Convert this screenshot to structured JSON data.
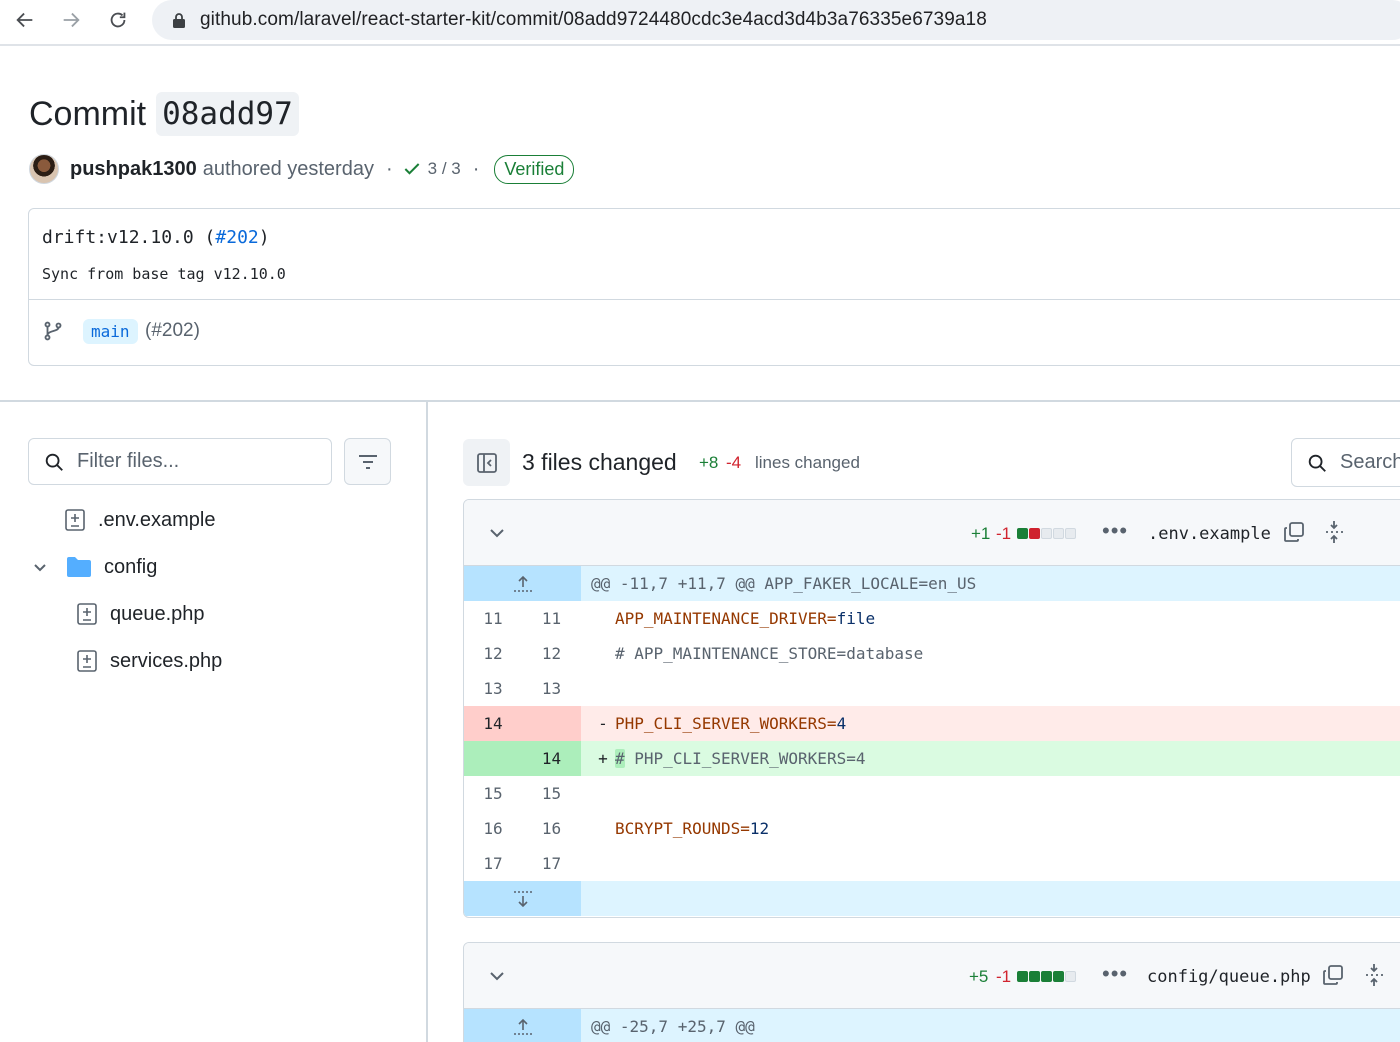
{
  "browser": {
    "url": "github.com/laravel/react-starter-kit/commit/08add9724480cdc3e4acd3d4b3a76335e6739a18"
  },
  "commit": {
    "title_word": "Commit",
    "short_sha": "08add97",
    "author": "pushpak1300",
    "authored_text": "authored yesterday",
    "separator": "·",
    "checks": "3 / 3",
    "verified": "Verified",
    "message_title_prefix": "drift:v12.10.0 (",
    "message_pr": "#202",
    "message_title_suffix": ")",
    "message_body": "Sync from base tag v12.10.0",
    "branch": "main",
    "branch_pr": "(#202)"
  },
  "file_tree": {
    "filter_placeholder": "Filter files...",
    "items": [
      {
        "name": ".env.example",
        "type": "file-diff"
      },
      {
        "name": "config",
        "type": "folder"
      },
      {
        "name": "queue.php",
        "type": "file-diff"
      },
      {
        "name": "services.php",
        "type": "file-diff"
      }
    ]
  },
  "diff_toolbar": {
    "files_changed": "3 files changed",
    "additions": "+8",
    "deletions": "-4",
    "lines_changed": "lines changed",
    "search_label": "Search"
  },
  "files": [
    {
      "additions": "+1",
      "deletions": "-1",
      "diffstat": [
        "add",
        "del",
        "neu",
        "neu",
        "neu"
      ],
      "more": "•••",
      "name": ".env.example",
      "hunk": "@@ -11,7 +11,7 @@ APP_FAKER_LOCALE=en_US",
      "lines": [
        {
          "old": "11",
          "new": "11",
          "type": "ctx",
          "sign": "",
          "key": "APP_MAINTENANCE_DRIVER",
          "eq": "=",
          "val": "file",
          "text": ""
        },
        {
          "old": "12",
          "new": "12",
          "type": "ctx",
          "sign": "",
          "key": "",
          "eq": "",
          "val": "",
          "text": "# APP_MAINTENANCE_STORE=database"
        },
        {
          "old": "13",
          "new": "13",
          "type": "ctx",
          "sign": "",
          "key": "",
          "eq": "",
          "val": "",
          "text": ""
        },
        {
          "old": "14",
          "new": "",
          "type": "del",
          "sign": "-",
          "key": "PHP_CLI_SERVER_WORKERS",
          "eq": "=",
          "val": "4",
          "text": ""
        },
        {
          "old": "",
          "new": "14",
          "type": "add",
          "sign": "+",
          "key": "",
          "eq": "",
          "val": "",
          "text": "PHP_CLI_SERVER_WORKERS=4",
          "hl": "#"
        },
        {
          "old": "15",
          "new": "15",
          "type": "ctx",
          "sign": "",
          "key": "",
          "eq": "",
          "val": "",
          "text": ""
        },
        {
          "old": "16",
          "new": "16",
          "type": "ctx",
          "sign": "",
          "key": "BCRYPT_ROUNDS",
          "eq": "=",
          "val": "12",
          "text": ""
        },
        {
          "old": "17",
          "new": "17",
          "type": "ctx",
          "sign": "",
          "key": "",
          "eq": "",
          "val": "",
          "text": ""
        }
      ]
    },
    {
      "additions": "+5",
      "deletions": "-1",
      "diffstat": [
        "add",
        "add",
        "add",
        "add",
        "neu"
      ],
      "more": "•••",
      "name": "config/queue.php",
      "hunk": "@@ -25,7 +25,7 @@"
    }
  ],
  "colors": {
    "addition": "#1a7f37",
    "deletion": "#d1242f",
    "link": "#0969da",
    "hunk_bg": "#ddf4ff"
  }
}
